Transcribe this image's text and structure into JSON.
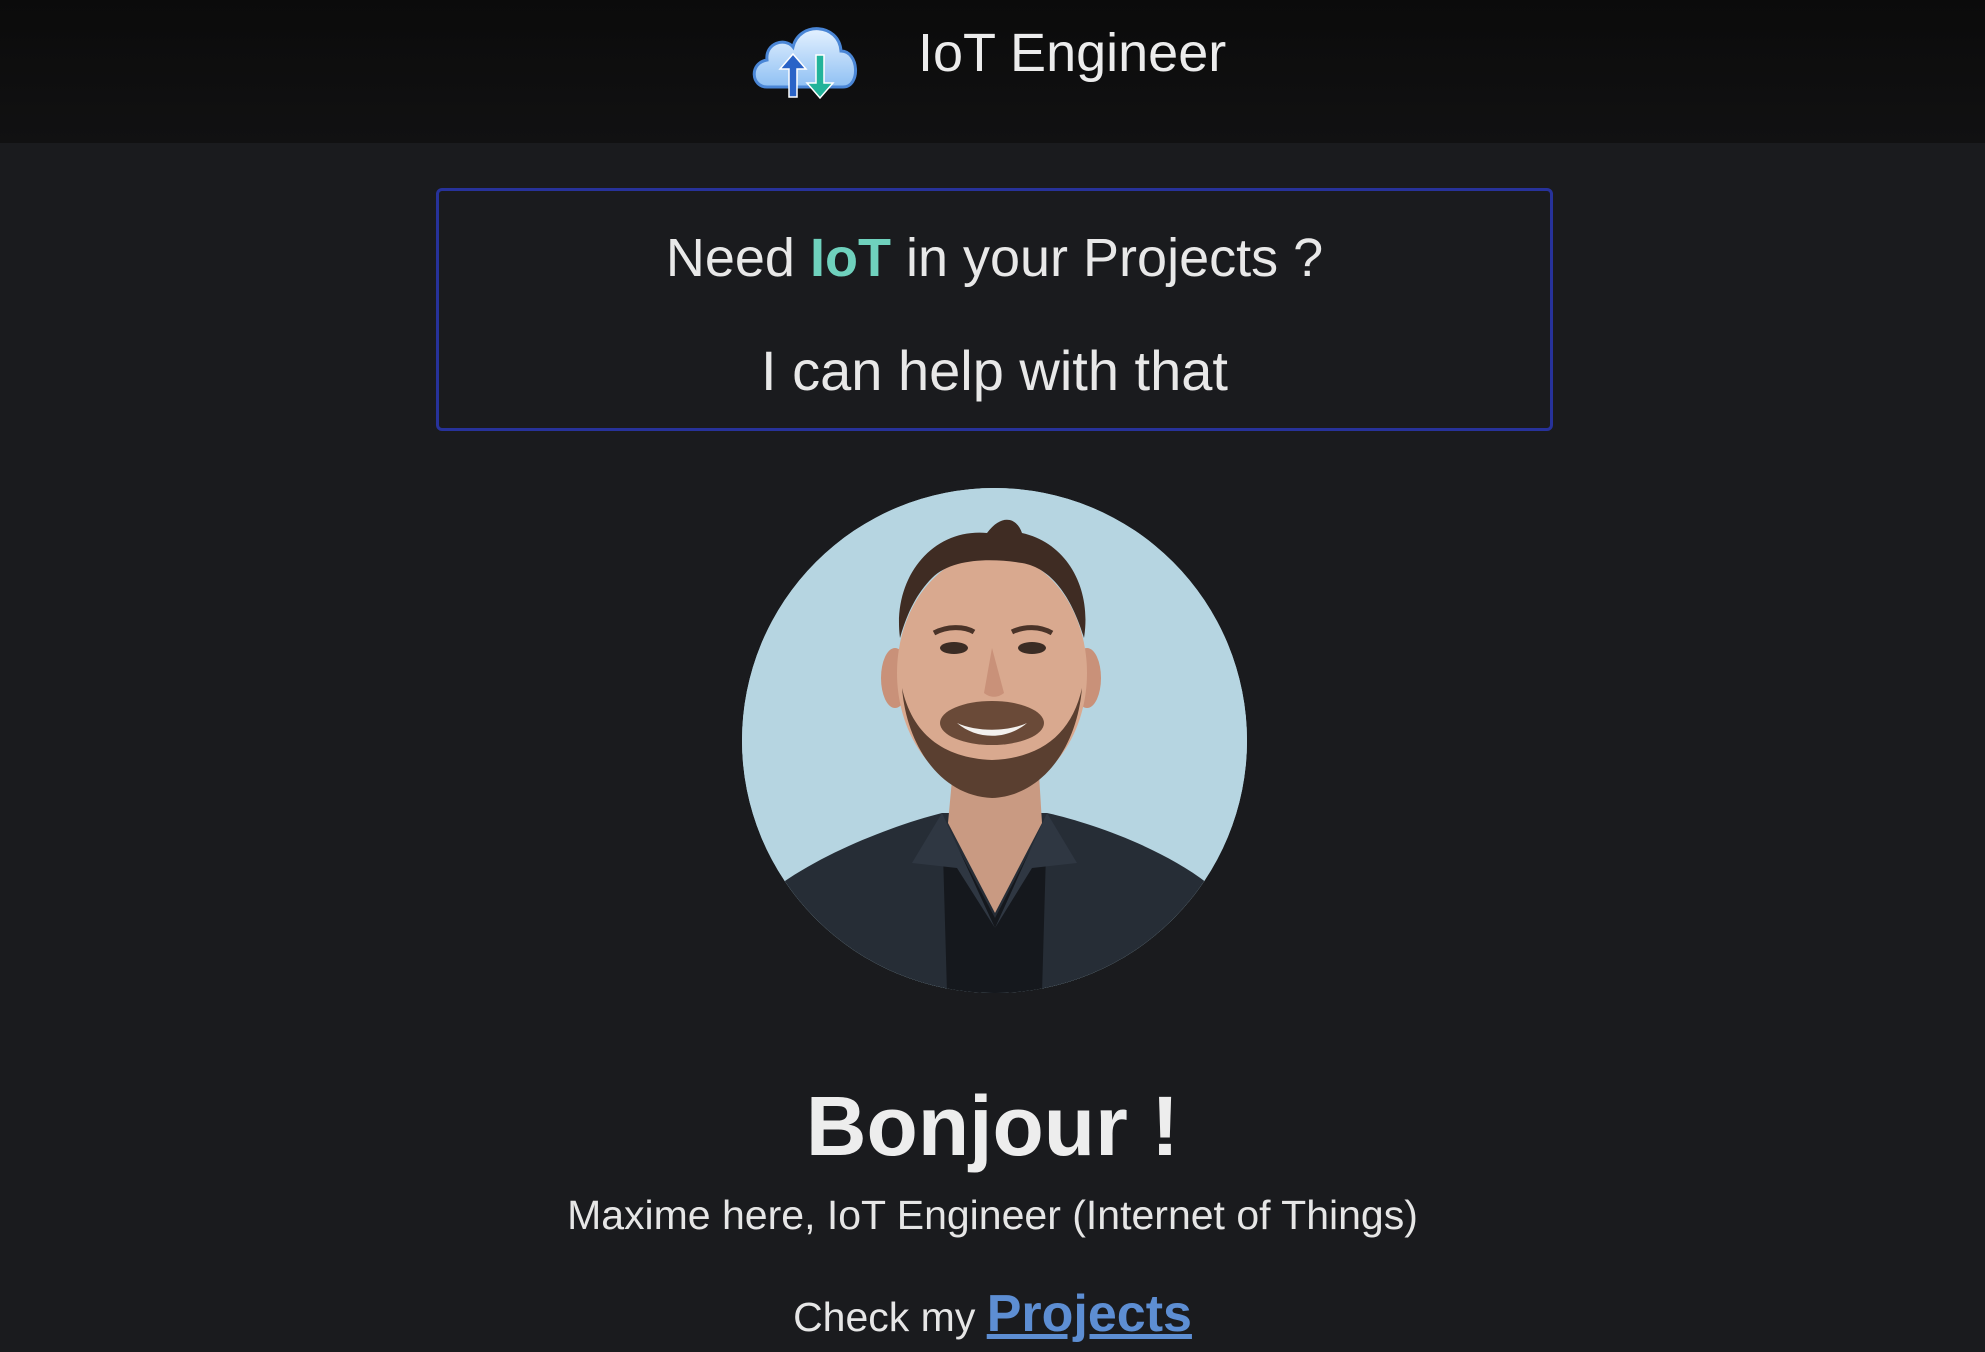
{
  "header": {
    "logo_icon": "cloud-upload-download-icon",
    "title": "IoT Engineer"
  },
  "pitch": {
    "line1_prefix": "Need ",
    "line1_accent": "IoT",
    "line1_suffix": " in your Projects ?",
    "line2": "I can help with that",
    "accent_color": "#6fd1bd",
    "border_color": "#27329a"
  },
  "profile": {
    "photo_icon": "profile-photo"
  },
  "main": {
    "greeting": "Bonjour !",
    "intro": "Maxime here, IoT Engineer (Internet of Things)",
    "cta_prefix": "Check my ",
    "cta_link": "Projects",
    "link_color": "#5d8ed3"
  }
}
